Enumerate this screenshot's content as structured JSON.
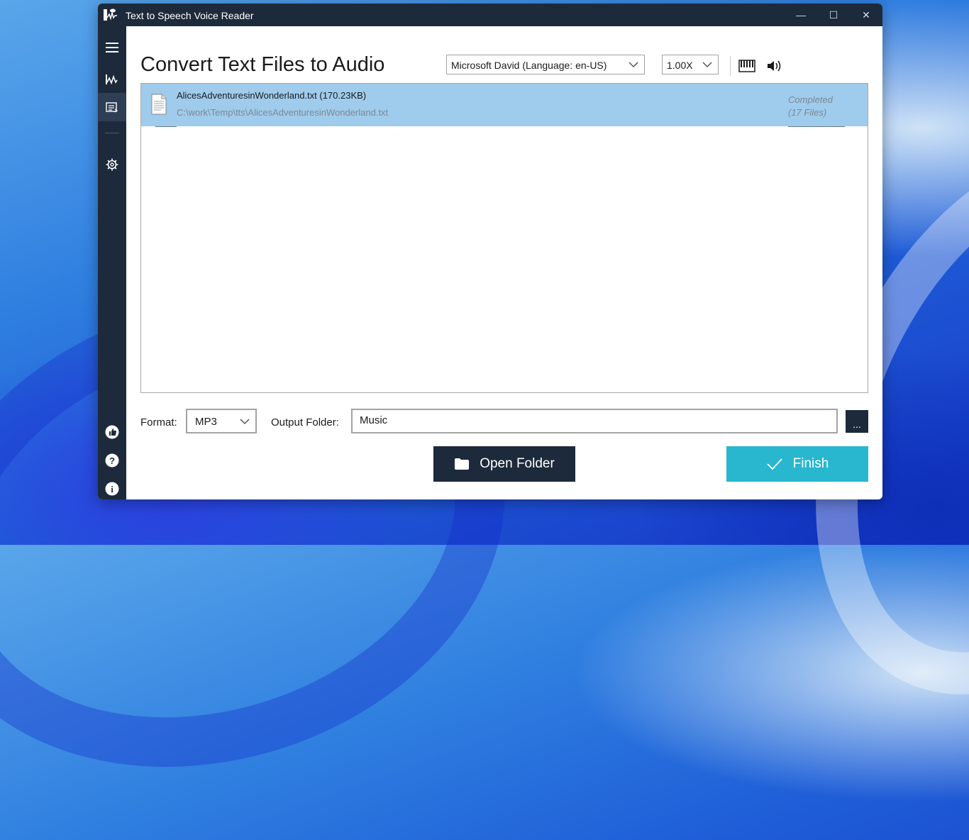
{
  "window": {
    "title": "Text to Speech Voice Reader",
    "controls": {
      "minimize": "—",
      "maximize": "☐",
      "close": "✕"
    }
  },
  "sidebar": {
    "items": [
      {
        "name": "menu",
        "icon": "hamburger-icon"
      },
      {
        "name": "text-to-speech",
        "icon": "speech-wave-icon"
      },
      {
        "name": "convert-files",
        "icon": "convert-list-icon",
        "active": true
      },
      {
        "name": "settings",
        "icon": "gear-icon"
      }
    ],
    "bottom_items": [
      {
        "name": "like",
        "icon": "thumbs-up-icon"
      },
      {
        "name": "help",
        "icon": "help-icon",
        "glyph": "?"
      },
      {
        "name": "about",
        "icon": "info-icon",
        "glyph": "i"
      }
    ]
  },
  "main": {
    "title": "Convert Text Files to Audio",
    "voice_select": {
      "value": "Microsoft David (Language: en-US)"
    },
    "speed_select": {
      "value": "1.00X"
    },
    "files": [
      {
        "name": "AlicesAdventuresinWonderland.txt (170.23KB)",
        "path": "C:\\work\\Temp\\tts\\AlicesAdventuresinWonderland.txt",
        "status_line1": "Completed",
        "status_line2": "(17 Files)"
      }
    ],
    "format_label": "Format:",
    "format_value": "MP3",
    "output_label": "Output Folder:",
    "output_value": "Music",
    "browse_label": "...",
    "open_folder_label": "Open Folder",
    "finish_label": "Finish"
  },
  "colors": {
    "dark": "#1d2a3b",
    "selected_row": "#9fcbec",
    "finish": "#29b6cf"
  }
}
